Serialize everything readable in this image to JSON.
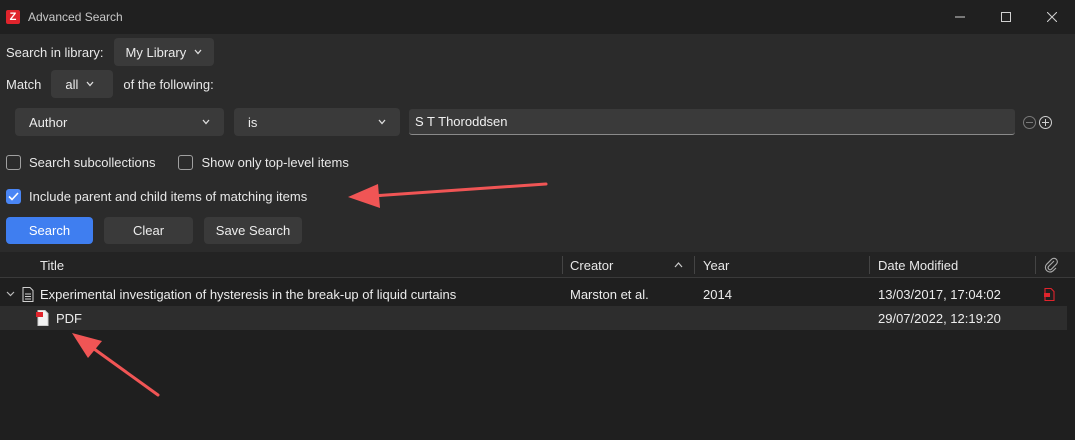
{
  "window": {
    "title": "Advanced Search",
    "app_icon_letter": "Z"
  },
  "search": {
    "library_label": "Search in library:",
    "library_value": "My Library",
    "match_label": "Match",
    "match_value": "all",
    "match_suffix": "of the following:",
    "condition": {
      "field": "Author",
      "operator": "is",
      "value": "S T Thoroddsen"
    },
    "options": {
      "subcollections": {
        "label": "Search subcollections",
        "checked": false
      },
      "top_level": {
        "label": "Show only top-level items",
        "checked": false
      },
      "include_parent_child": {
        "label": "Include parent and child items of matching items",
        "checked": true
      }
    },
    "buttons": {
      "search": "Search",
      "clear": "Clear",
      "save": "Save Search"
    }
  },
  "table": {
    "columns": {
      "title": "Title",
      "creator": "Creator",
      "year": "Year",
      "date_modified": "Date Modified"
    },
    "rows": [
      {
        "title": "Experimental investigation of hysteresis in the break-up of liquid curtains",
        "creator": "Marston et al.",
        "year": "2014",
        "date_modified": "13/03/2017, 17:04:02"
      },
      {
        "title": "PDF",
        "creator": "",
        "year": "",
        "date_modified": "29/07/2022, 12:19:20"
      }
    ]
  },
  "colors": {
    "accent": "#3f7ef0",
    "annotation_arrow": "#f05555",
    "pdf_icon": "#e0242c"
  }
}
